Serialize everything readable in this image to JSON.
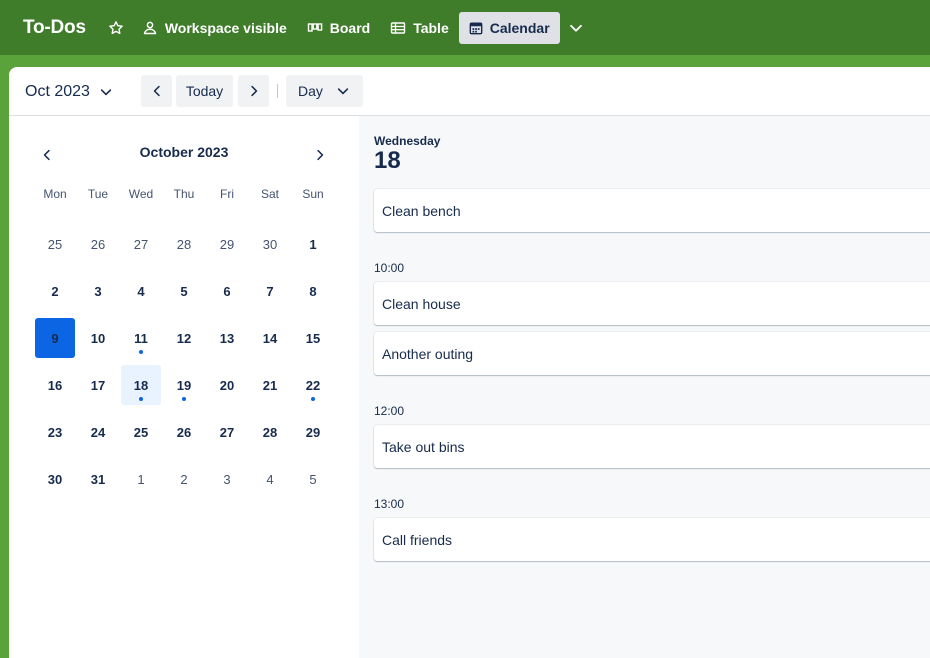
{
  "board": {
    "title": "To-Dos",
    "visibility_label": "Workspace visible",
    "views": [
      "Board",
      "Table",
      "Calendar"
    ],
    "active_view": "Calendar"
  },
  "toolbar": {
    "month_label": "Oct 2023",
    "today_label": "Today",
    "view_mode": "Day"
  },
  "mini_calendar": {
    "month_title": "October 2023",
    "weekdays": [
      "Mon",
      "Tue",
      "Wed",
      "Thu",
      "Fri",
      "Sat",
      "Sun"
    ],
    "weeks": [
      [
        "25",
        "26",
        "27",
        "28",
        "29",
        "30",
        "1"
      ],
      [
        "2",
        "3",
        "4",
        "5",
        "6",
        "7",
        "8"
      ],
      [
        "9",
        "10",
        "11",
        "12",
        "13",
        "14",
        "15"
      ],
      [
        "16",
        "17",
        "18",
        "19",
        "20",
        "21",
        "22"
      ],
      [
        "23",
        "24",
        "25",
        "26",
        "27",
        "28",
        "29"
      ],
      [
        "30",
        "31",
        "1",
        "2",
        "3",
        "4",
        "5"
      ]
    ],
    "today": "9",
    "selected": "18",
    "days_with_events": [
      "11",
      "18",
      "19",
      "22"
    ]
  },
  "day_view": {
    "weekday": "Wednesday",
    "day_number": "18",
    "groups": [
      {
        "time": "",
        "events": [
          "Clean bench"
        ]
      },
      {
        "time": "10:00",
        "events": [
          "Clean house",
          "Another outing"
        ]
      },
      {
        "time": "12:00",
        "events": [
          "Take out bins"
        ]
      },
      {
        "time": "13:00",
        "events": [
          "Call friends"
        ]
      }
    ]
  },
  "colors": {
    "header_green": "#3f7d2b",
    "board_background": "#5aa33b",
    "today_highlight": "#0c66e4",
    "selected_day": "#e9f2ff",
    "event_dot": "#0c66e4"
  }
}
